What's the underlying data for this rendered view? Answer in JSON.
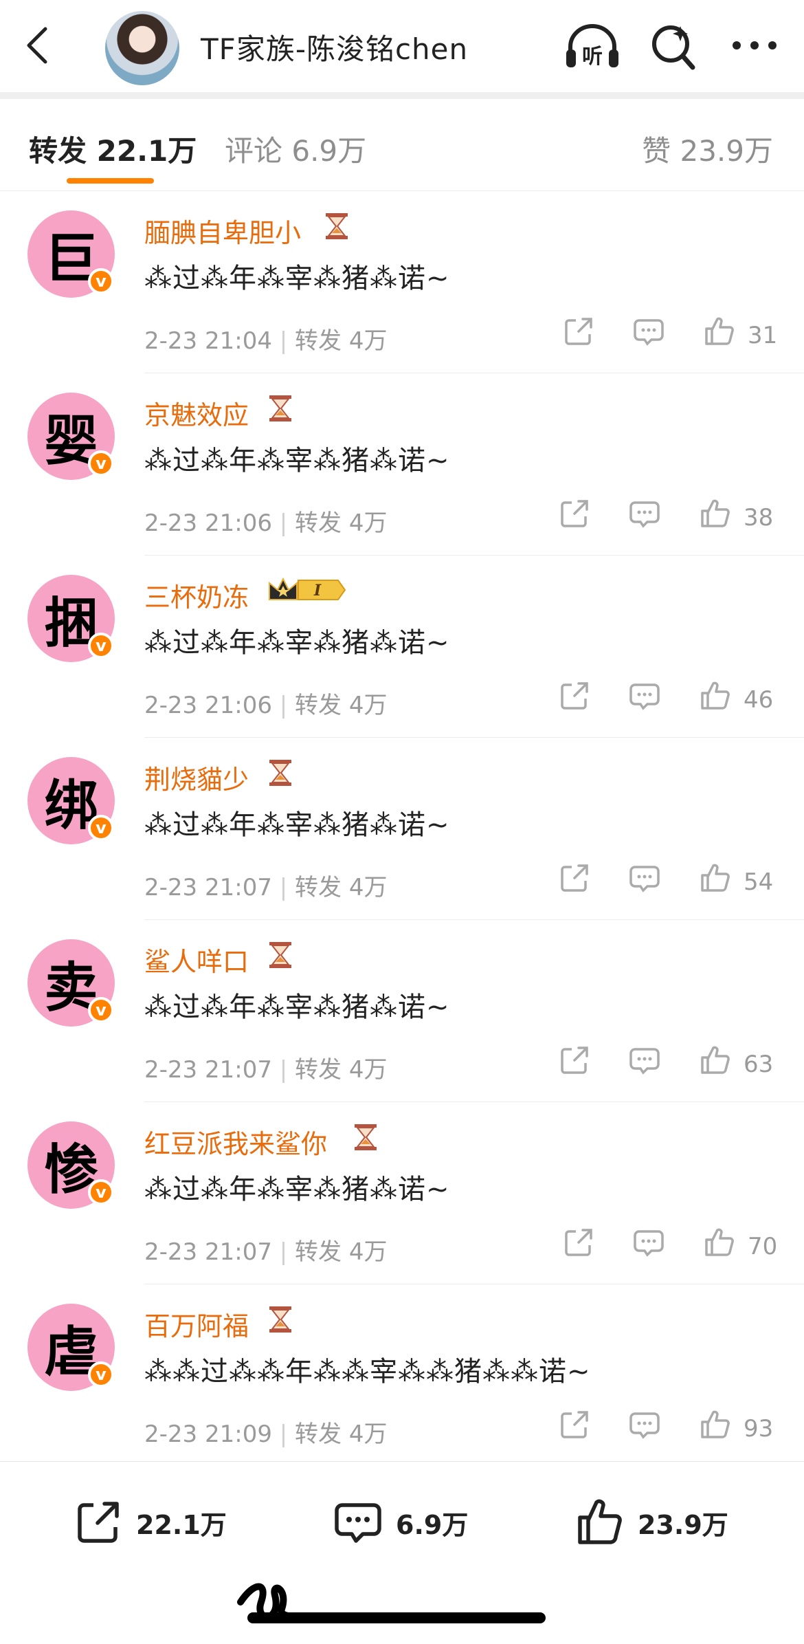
{
  "header": {
    "title": "TF家族-陈浚铭chen",
    "icons": [
      "back-icon",
      "listen-icon",
      "search-sparkle-icon",
      "more-icon"
    ],
    "listen_label": "听"
  },
  "tabs": {
    "repost": "转发 22.1万",
    "comment": "评论 6.9万",
    "like": "赞 23.9万",
    "accent": "#ff8200"
  },
  "reposts": [
    {
      "avatar_char": "巨",
      "name": "腼腆自卑胆小",
      "badge": "hourglass",
      "content": "⁂过⁂年⁂宰⁂猪⁂诺~",
      "time": "2-23 21:04",
      "repost": "转发 4万",
      "likes": "31"
    },
    {
      "avatar_char": "婴",
      "name": "京魅效应",
      "badge": "hourglass",
      "content": "⁂过⁂年⁂宰⁂猪⁂诺~",
      "time": "2-23 21:06",
      "repost": "转发 4万",
      "likes": "38"
    },
    {
      "avatar_char": "捆",
      "name": "三杯奶冻",
      "badge": "crown",
      "badge_text": "I",
      "content": "⁂过⁂年⁂宰⁂猪⁂诺~",
      "time": "2-23 21:06",
      "repost": "转发 4万",
      "likes": "46"
    },
    {
      "avatar_char": "绑",
      "name": "荆烧貓少",
      "badge": "hourglass",
      "content": "⁂过⁂年⁂宰⁂猪⁂诺~",
      "time": "2-23 21:07",
      "repost": "转发 4万",
      "likes": "54"
    },
    {
      "avatar_char": "卖",
      "name": "鲨人咩口",
      "badge": "hourglass",
      "content": "⁂过⁂年⁂宰⁂猪⁂诺~",
      "time": "2-23 21:07",
      "repost": "转发 4万",
      "likes": "63"
    },
    {
      "avatar_char": "惨",
      "name": "红豆派我来鲨你",
      "badge": "hourglass",
      "content": "⁂过⁂年⁂宰⁂猪⁂诺~",
      "time": "2-23 21:07",
      "repost": "转发 4万",
      "likes": "70"
    },
    {
      "avatar_char": "虐",
      "name": "百万阿福",
      "badge": "hourglass",
      "content": "⁂⁂过⁂⁂年⁂⁂宰⁂⁂猪⁂⁂诺~",
      "time": "2-23 21:09",
      "repost": "转发 4万",
      "likes": "93"
    }
  ],
  "bottom_bar": {
    "repost": "22.1万",
    "comment": "6.9万",
    "like": "23.9万"
  },
  "colors": {
    "username": "#e86b0c",
    "avatar_bg": "#f6a3c6",
    "verified": "#ff8200"
  }
}
